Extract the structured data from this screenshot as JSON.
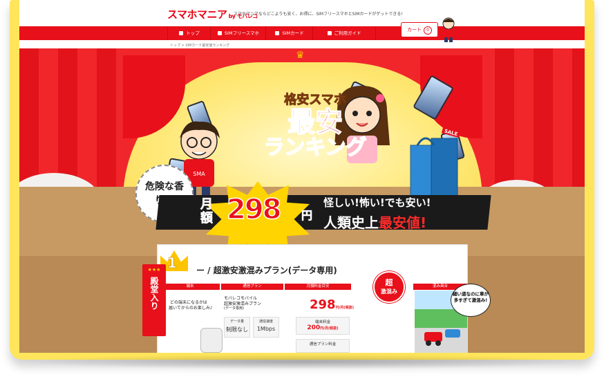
{
  "header": {
    "logo_text": "スマホマニア",
    "logo_by": "by モバレコ",
    "tagline": "スマホマニアならどこよりも安く、お得に、SIMフリースマホとSIMカードがゲットできる!",
    "cart_label": "カート",
    "cart_count": "0"
  },
  "nav": {
    "items": [
      {
        "label": "トップ",
        "icon": "home-icon"
      },
      {
        "label": "SIMフリースマホ",
        "icon": "phone-icon"
      },
      {
        "label": "SIMカード",
        "icon": "sim-card-icon"
      },
      {
        "label": "ご利用ガイド",
        "icon": "guide-icon"
      }
    ]
  },
  "breadcrumb": "トップ > SIMカード最安値ランキング",
  "hero": {
    "title_sub": "格安スマホ",
    "title_main": "最安",
    "title_rank": "ランキング",
    "sale_tag": "SALE",
    "badge_text": "危険な香り!?",
    "price_label": "月額",
    "price_value": "298",
    "price_unit": "円",
    "slogan_1": "怪しい!怖い!でも安い!",
    "slogan_2_a": "人類史上",
    "slogan_2_b": "最安値!",
    "shirt_text": "SMA"
  },
  "ranking": {
    "rank_number": "1",
    "title": "ー / 超激安激混みプラン(データ専用)",
    "hall_of_fame": "殿堂入り",
    "hall_stars": "★★★",
    "columns": [
      "端末",
      "通信プラン",
      "月額料金目安",
      "混み具合"
    ],
    "device_text_1": "どの端末になるかは",
    "device_text_2": "届いてからのお楽しみ♪",
    "plan_provider": "モバレコモバイル",
    "plan_name": "超激安激混みプラン",
    "plan_note": "(データ専用)",
    "data_capacity_label": "データ量",
    "data_capacity_value": "制限なし",
    "speed_label": "通信速度",
    "speed_value": "1Mbps",
    "monthly_price": "298",
    "monthly_price_unit": "円/月(税抜)",
    "device_fee_label": "端末料金",
    "device_fee_value": "200",
    "device_fee_unit": "円/月(税抜)",
    "plan_fee_label": "通信プラン料金",
    "stamp_line1": "超",
    "stamp_line2": "激混み",
    "speech_text": "細い道なのに車が多すぎて激混み!"
  },
  "colors": {
    "brand_red": "#e8101a",
    "frame_yellow": "#ffe55c",
    "star_yellow": "#ffd400"
  }
}
